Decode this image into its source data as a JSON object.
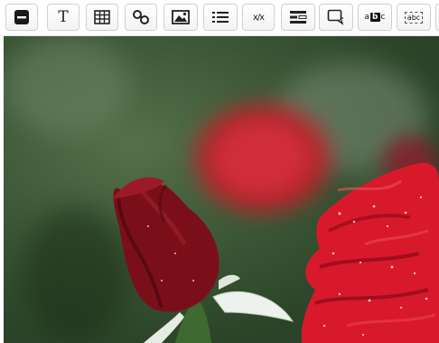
{
  "toolbar": {
    "tools": [
      {
        "name": "block",
        "icon": "block-icon"
      },
      {
        "name": "text",
        "icon": "text-icon",
        "label": "T"
      },
      {
        "name": "table",
        "icon": "table-icon"
      },
      {
        "name": "link",
        "icon": "link-icon"
      },
      {
        "name": "image",
        "icon": "image-icon"
      },
      {
        "name": "list",
        "icon": "list-icon"
      },
      {
        "name": "fraction",
        "icon": "fraction-icon",
        "label": "x/x"
      },
      {
        "name": "form-fields",
        "icon": "form-fields-icon"
      },
      {
        "name": "comment",
        "icon": "comment-icon"
      },
      {
        "name": "inline-choice",
        "icon": "inline-choice-icon",
        "label_a": "a",
        "label_b": "b",
        "label_c": "c"
      },
      {
        "name": "text-entry",
        "icon": "text-entry-icon",
        "label": "abc"
      }
    ]
  },
  "photo": {
    "subject": "red-rose-photo",
    "colors": {
      "background": "#3e5a38",
      "rose_dark": "#7a0f1a",
      "rose_bright": "#d8192b",
      "sepal": "#e8eee6"
    }
  }
}
